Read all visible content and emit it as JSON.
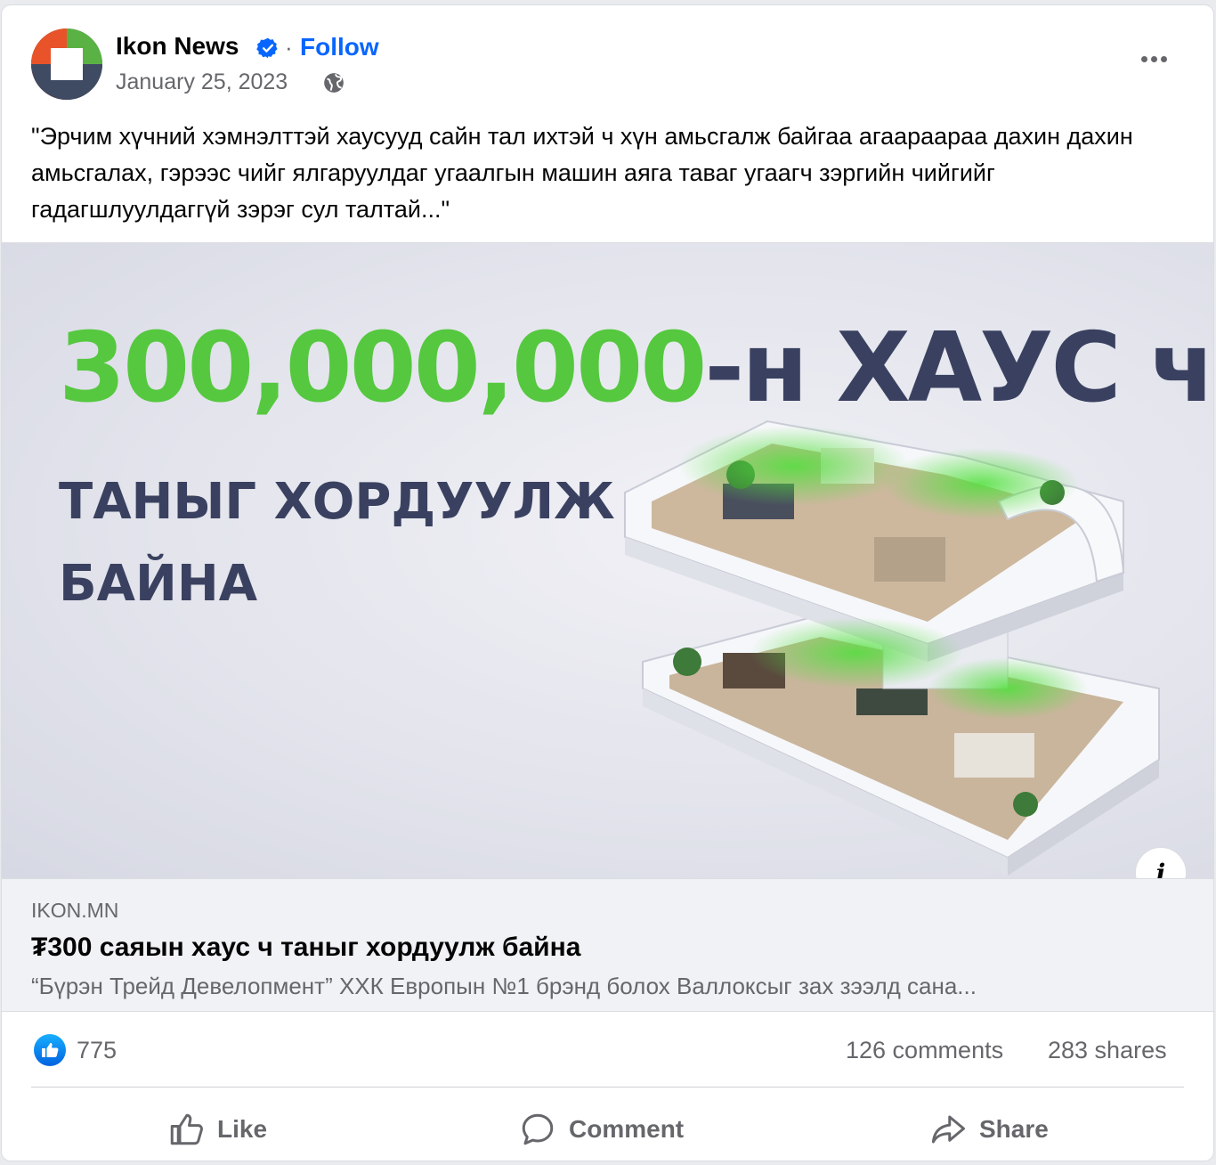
{
  "header": {
    "page_name": "Ikon News",
    "separator": "·",
    "follow_label": "Follow",
    "date": "January 25, 2023",
    "date_separator": "·"
  },
  "post": {
    "text": "\"Эрчим хүчний хэмнэлттэй хаусууд сайн тал ихтэй ч хүн амьсгалж байгаа агаараараа дахин дахин амьсгалах, гэрээс чийг ялгаруулдаг угаалгын машин аяга таваг угаагч зэргийн чийгийг гадагшлуулдаггүй зэрэг сул талтай...\""
  },
  "image": {
    "headline_number": "300,000,000",
    "headline_rest": "-н ХАУС ч",
    "subline_1": "ТАНЫГ ХОРДУУЛЖ",
    "subline_2": "БАЙНА",
    "info_label": "i"
  },
  "link": {
    "domain": "IKON.MN",
    "title": "₮300 саяын хаус ч таныг хордуулж байна",
    "description": "“Бүрэн Трейд Девелопмент” ХХК Европын №1 брэнд болох Валлоксыг зах зээлд сана..."
  },
  "stats": {
    "reactions": "775",
    "comments": "126 comments",
    "shares": "283 shares"
  },
  "actions": {
    "like": "Like",
    "comment": "Comment",
    "share": "Share"
  },
  "colors": {
    "accent": "#0866ff",
    "headline_green": "#55c83f",
    "headline_navy": "#3a4160"
  }
}
